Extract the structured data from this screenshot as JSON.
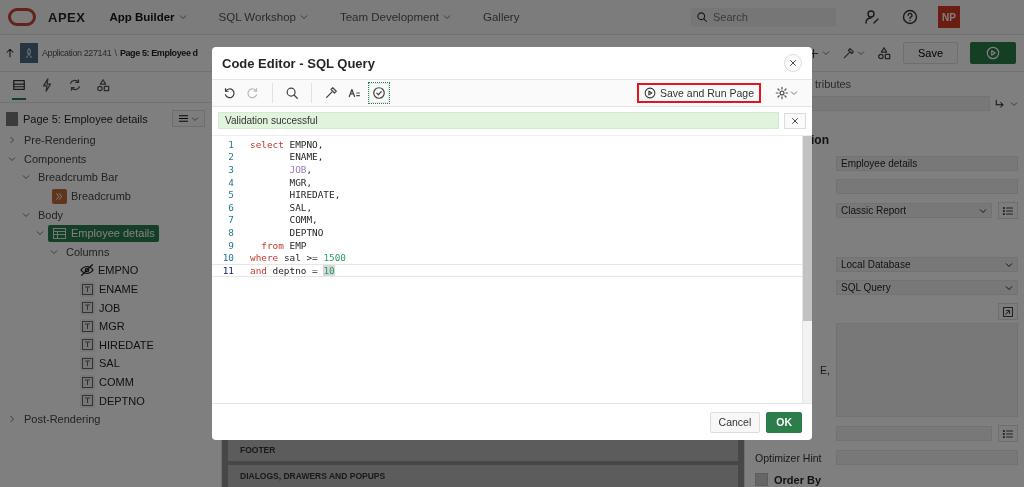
{
  "header": {
    "brand": "APEX",
    "nav": [
      {
        "label": "App Builder",
        "selected": true,
        "has_menu": true
      },
      {
        "label": "SQL Workshop",
        "selected": false,
        "has_menu": true
      },
      {
        "label": "Team Development",
        "selected": false,
        "has_menu": true
      },
      {
        "label": "Gallery",
        "selected": false,
        "has_menu": false
      }
    ],
    "search": {
      "placeholder": "Search"
    },
    "avatar": "NP"
  },
  "toolbar": {
    "breadcrumb": [
      "Application 227141",
      "Page 5: Employee d"
    ],
    "separator": "\\",
    "save_label": "Save"
  },
  "left_panel": {
    "tabs": [
      {
        "kind": "rendering",
        "selected": true
      },
      {
        "kind": "dynamic-actions",
        "selected": false
      },
      {
        "kind": "processing",
        "selected": false
      },
      {
        "kind": "shared",
        "selected": false
      }
    ],
    "page_title": "Page 5: Employee details",
    "tree": [
      {
        "label": "Pre-Rendering",
        "expanded": false,
        "selected": false
      },
      {
        "label": "Components",
        "expanded": true,
        "selected": false,
        "children": [
          {
            "label": "Breadcrumb Bar",
            "expanded": true,
            "selected": false,
            "children": [
              {
                "label": "Breadcrumb",
                "kind": "breadcrumb",
                "selected": false
              }
            ]
          },
          {
            "label": "Body",
            "expanded": true,
            "selected": false,
            "children": [
              {
                "label": "Employee details",
                "kind": "region",
                "expanded": true,
                "selected": true,
                "children": [
                  {
                    "label": "Columns",
                    "expanded": true,
                    "selected": false,
                    "children": [
                      {
                        "label": "EMPNO",
                        "kind": "hidden-column",
                        "selected": false
                      },
                      {
                        "label": "ENAME",
                        "kind": "text-column",
                        "selected": false
                      },
                      {
                        "label": "JOB",
                        "kind": "text-column",
                        "selected": false
                      },
                      {
                        "label": "MGR",
                        "kind": "text-column",
                        "selected": false
                      },
                      {
                        "label": "HIREDATE",
                        "kind": "text-column",
                        "selected": false
                      },
                      {
                        "label": "SAL",
                        "kind": "text-column",
                        "selected": false
                      },
                      {
                        "label": "COMM",
                        "kind": "text-column",
                        "selected": false
                      },
                      {
                        "label": "DEPTNO",
                        "kind": "text-column",
                        "selected": false
                      }
                    ]
                  }
                ]
              }
            ]
          }
        ]
      },
      {
        "label": "Post-Rendering",
        "expanded": false,
        "selected": false
      }
    ]
  },
  "center": {
    "sections": [
      "FOOTER",
      "DIALOGS, DRAWERS AND POPUPS"
    ]
  },
  "right_panel": {
    "tab_label": "tributes",
    "section_title": "ion",
    "fields": [
      {
        "kind": "text",
        "value": "Employee details"
      },
      {
        "kind": "text"
      },
      {
        "kind": "select-list",
        "value": "Classic Report"
      },
      {
        "kind": "gap"
      },
      {
        "kind": "select",
        "value": "Local Database"
      },
      {
        "kind": "select",
        "value": "SQL Query"
      },
      {
        "kind": "expand"
      },
      {
        "kind": "code",
        "fragment": "E,"
      },
      {
        "kind": "text-list"
      },
      {
        "kind": "text",
        "label": "Optimizer Hint"
      },
      {
        "kind": "checkbox",
        "label": "Order By",
        "checked": false
      }
    ]
  },
  "dialog": {
    "title": "Code Editor - SQL Query",
    "tools": [
      {
        "kind": "undo",
        "disabled": false,
        "selected": false
      },
      {
        "kind": "redo",
        "disabled": true,
        "selected": false
      },
      {
        "kind": "separator"
      },
      {
        "kind": "search",
        "disabled": false,
        "selected": false
      },
      {
        "kind": "separator"
      },
      {
        "kind": "wrench",
        "disabled": false,
        "selected": false
      },
      {
        "kind": "format",
        "disabled": false,
        "selected": false
      },
      {
        "kind": "validate",
        "disabled": false,
        "selected": true
      }
    ],
    "run_button": {
      "label": "Save and Run Page",
      "highlighted": true
    },
    "message": "Validation successful",
    "code": [
      {
        "n": "1",
        "active": false,
        "tokens": [
          {
            "kind": "keyword",
            "t": "select"
          },
          {
            "kind": "text",
            "t": " EMPNO,"
          }
        ]
      },
      {
        "n": "2",
        "active": false,
        "tokens": [
          {
            "kind": "text",
            "t": "       ENAME,"
          }
        ]
      },
      {
        "n": "3",
        "active": false,
        "tokens": [
          {
            "kind": "builtin",
            "t": "       JOB"
          },
          {
            "kind": "text",
            "t": ","
          }
        ]
      },
      {
        "n": "4",
        "active": false,
        "tokens": [
          {
            "kind": "text",
            "t": "       MGR,"
          }
        ]
      },
      {
        "n": "5",
        "active": false,
        "tokens": [
          {
            "kind": "text",
            "t": "       HIREDATE,"
          }
        ]
      },
      {
        "n": "6",
        "active": false,
        "tokens": [
          {
            "kind": "text",
            "t": "       SAL,"
          }
        ]
      },
      {
        "n": "7",
        "active": false,
        "tokens": [
          {
            "kind": "text",
            "t": "       COMM,"
          }
        ]
      },
      {
        "n": "8",
        "active": false,
        "tokens": [
          {
            "kind": "text",
            "t": "       DEPTNO"
          }
        ]
      },
      {
        "n": "9",
        "active": false,
        "tokens": [
          {
            "kind": "keyword",
            "t": "  from"
          },
          {
            "kind": "text",
            "t": " EMP"
          }
        ]
      },
      {
        "n": "10",
        "active": false,
        "tokens": [
          {
            "kind": "keyword",
            "t": "where"
          },
          {
            "kind": "text",
            "t": " sal >= "
          },
          {
            "kind": "number",
            "t": "1500"
          }
        ]
      },
      {
        "n": "11",
        "active": true,
        "tokens": [
          {
            "kind": "keyword",
            "t": "and"
          },
          {
            "kind": "text",
            "t": " deptno = "
          },
          {
            "kind": "number-match",
            "t": "10"
          }
        ]
      }
    ],
    "buttons": [
      {
        "label": "Cancel",
        "kind": "secondary"
      },
      {
        "label": "OK",
        "kind": "primary"
      }
    ]
  }
}
